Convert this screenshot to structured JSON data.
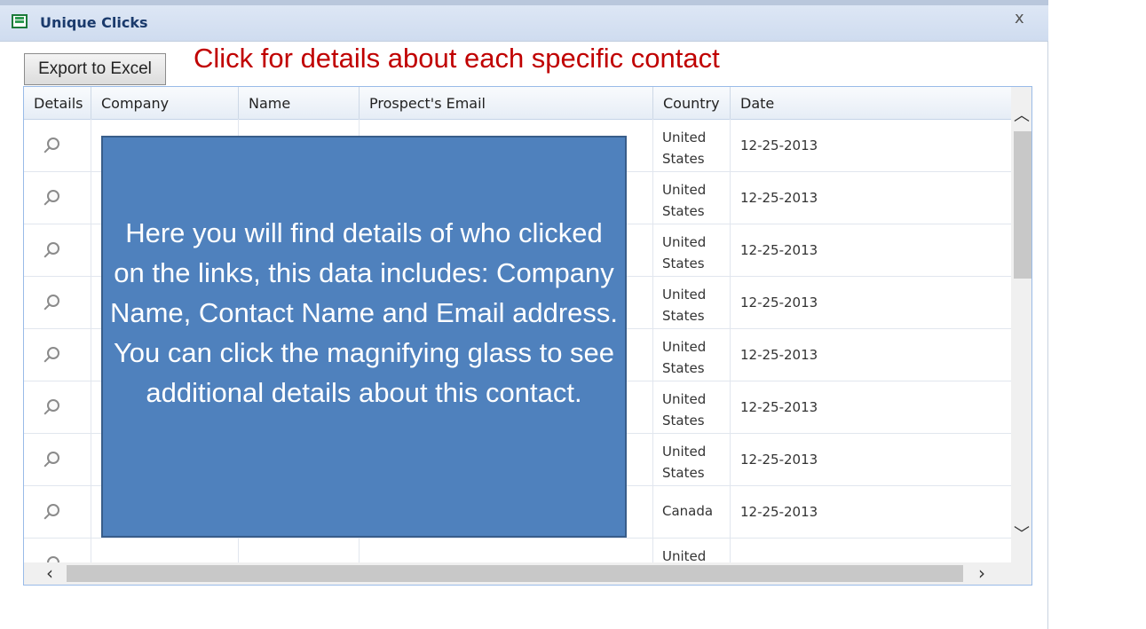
{
  "window": {
    "title": "Unique Clicks",
    "close_glyph": "x"
  },
  "toolbar": {
    "export_label": "Export to Excel"
  },
  "caption": "Click for details about each specific contact",
  "grid": {
    "columns": [
      "Details",
      "Company",
      "Name",
      "Prospect's Email",
      "Country",
      "Date"
    ],
    "rows": [
      {
        "country": "United States",
        "date": "12-25-2013"
      },
      {
        "country": "United States",
        "date": "12-25-2013"
      },
      {
        "country": "United States",
        "date": "12-25-2013"
      },
      {
        "country": "United States",
        "date": "12-25-2013"
      },
      {
        "country": "United States",
        "date": "12-25-2013"
      },
      {
        "country": "United States",
        "date": "12-25-2013"
      },
      {
        "country": "United States",
        "date": "12-25-2013"
      },
      {
        "country": "Canada",
        "date": "12-25-2013"
      },
      {
        "country": "United",
        "date": ""
      }
    ],
    "details_icon": "magnifier-icon"
  },
  "callout": {
    "text": "Here you will find details of who clicked on the links, this data includes: Company Name, Contact Name and Email address. You can click the magnifying glass to see additional details about this contact."
  },
  "colors": {
    "caption": "#c00000",
    "callout_fill": "#4f81bd",
    "callout_border": "#385d8a",
    "title_text": "#1a3a6c"
  }
}
